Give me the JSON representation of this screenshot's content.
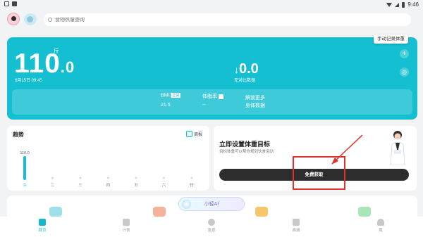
{
  "status_bar": {
    "time": "9:46"
  },
  "search": {
    "placeholder": "食物热量查询"
  },
  "weight_card": {
    "weight_int": "110",
    "weight_dec": ".0",
    "unit": "斤",
    "date": "6月15日 09:45",
    "change_value": "0.0",
    "change_label": "无对比数据",
    "tooltip": "手动记录体重",
    "bmi_label": "BMI",
    "bmi_tag": "正常",
    "bmi_value": "21.5",
    "fat_label": "体脂率",
    "fat_value": "--",
    "more_line1": "解锁更多",
    "more_line2": "身体数据"
  },
  "trend": {
    "title": "趋势",
    "week_label": "周报"
  },
  "chart_data": {
    "type": "bar",
    "categories": [
      "今",
      "二",
      "三",
      "四",
      "五",
      "六",
      "日"
    ],
    "values": [
      110.0,
      null,
      null,
      null,
      null,
      null,
      null
    ],
    "data_label": "110.0",
    "title": "趋势"
  },
  "goal": {
    "title": "立即设置体重目标",
    "subtitle": "目标体重可以帮你规划饮食运动",
    "button": "免费获取"
  },
  "ai": {
    "label": "小轻AI"
  },
  "tabs": [
    {
      "label": "首页"
    },
    {
      "label": "计划"
    },
    {
      "label": "发现"
    },
    {
      "label": "商城"
    },
    {
      "label": "我"
    }
  ],
  "colors": {
    "accent": "#14bfd1",
    "button": "#2d2d2d",
    "annotation": "#e0302b"
  }
}
